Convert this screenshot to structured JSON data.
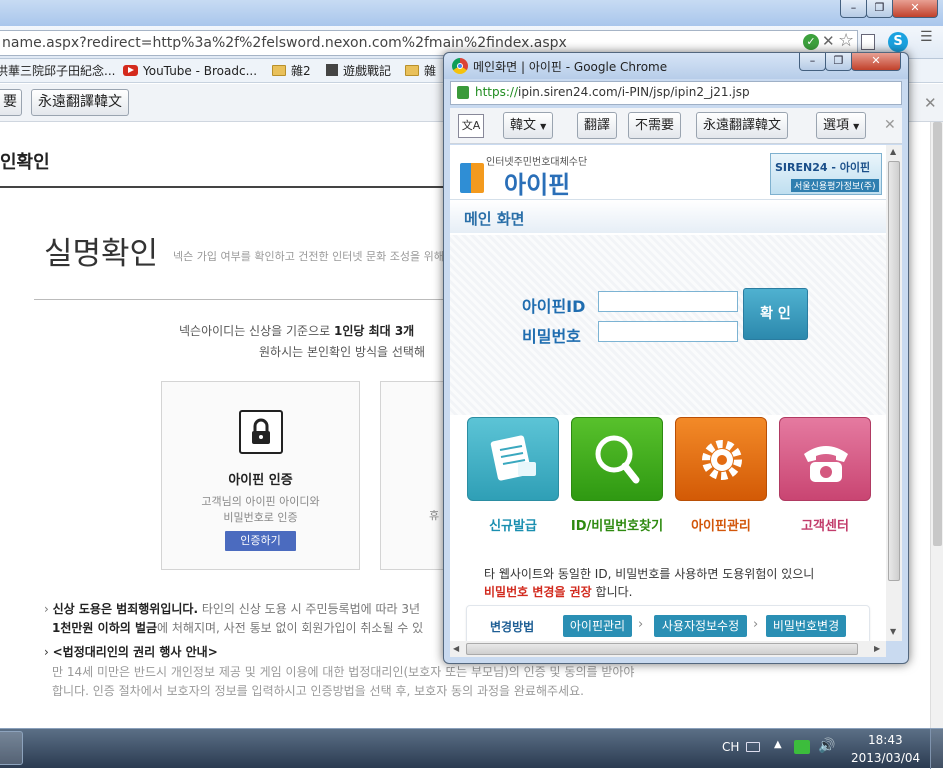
{
  "bg_browser": {
    "url": "name.aspx?redirect=http%3a%2f%2felsword.nexon.com%2fmain%2findex.aspx",
    "bookmarks": [
      "洪華三院邱子田紀念...",
      "YouTube - Broadc...",
      "雜2",
      "遊戲戰記",
      "雜"
    ],
    "translate_bar": {
      "never": "要",
      "always": "永遠翻譯韓文"
    },
    "page": {
      "header": "인확인",
      "title": "실명확인",
      "subtitle": "넥슨 가입 여부를 확인하고 건전한 인터넷 문화 조성을 위해",
      "intro_line1a": "넥슨아이디는 신상을 기준으로 ",
      "intro_line1b": "1인당 최대 3개",
      "intro_line2": "원하시는 본인확인 방식을 선택해",
      "card1": {
        "title": "아이핀 인증",
        "desc1": "고객님의 아이핀 아이디와",
        "desc2": "비밀번호로 인증",
        "button": "인증하기"
      },
      "card2": {
        "desc": "휴"
      },
      "notice1_bold": "신상 도용은 범죄행위입니다.",
      "notice1_rest": " 타인의 신상 도용 시 주민등록법에 따라 3년",
      "notice1_line2_bold": "1천만원 이하의 벌금",
      "notice1_line2_rest": "에 처해지며, 사전 통보 없이 회원가입이 취소될 수 있",
      "notice2_title": "<법정대리인의 권리 행사 안내>",
      "notice2_line1": "만 14세 미만은 반드시 개인정보 제공 및 게임 이용에 대한 법정대리인(보호자 또는 부모님)의 인증 및 동의를 받아야",
      "notice2_line2": "합니다. 인증 절차에서 보호자의 정보를 입력하시고 인증방법을 선택 후, 보호자 동의 과정을 완료해주세요."
    }
  },
  "popup": {
    "title": "메인화면 | 아이핀 - Google Chrome",
    "url_scheme": "https://",
    "url_rest": "ipin.siren24.com/i-PIN/jsp/ipin2_j21.jsp",
    "translate": {
      "lang": "韓文",
      "translate": "翻譯",
      "never": "不需要",
      "always": "永遠翻譯韓文",
      "options": "選項"
    },
    "page": {
      "logo_sub": "인터넷주민번호대체수단",
      "logo_main": "아이핀",
      "siren_badge": "SIREN24 - 아이핀",
      "siren_sub": "서울신용평가정보(주)",
      "section_title": "메인 화면",
      "id_label": "아이핀ID",
      "pw_label": "비밀번호",
      "confirm_button": "확 인",
      "tiles": [
        {
          "label": "신규발급",
          "color": "#3fb3c7",
          "label_color": "#1a8fb0"
        },
        {
          "label": "ID/비밀번호찾기",
          "color": "#3aa21a",
          "label_color": "#2e8a10"
        },
        {
          "label": "아이핀관리",
          "color": "#e66a0c",
          "label_color": "#d2560a"
        },
        {
          "label": "고객센터",
          "color": "#d65f86",
          "label_color": "#c23c6b"
        }
      ],
      "warning_line1": "타 웹사이트와 동일한 ID, 비밀번호를 사용하면 도용위험이 있으니",
      "warning_bold": "비밀번호 변경을 권장",
      "warning_end": " 합니다.",
      "change_method": "변경방법",
      "steps": [
        "아이핀관리",
        "사용자정보수정",
        "비밀번호변경"
      ]
    }
  },
  "taskbar": {
    "lang": "CH",
    "time": "18:43",
    "date": "2013/03/04"
  }
}
